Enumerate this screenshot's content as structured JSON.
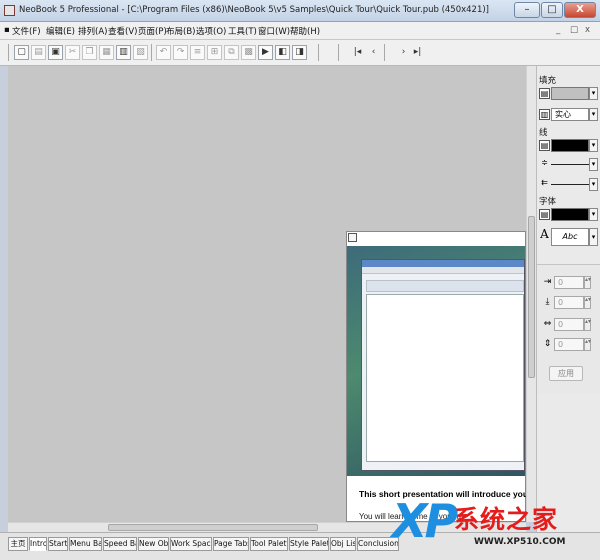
{
  "window": {
    "title": "NeoBook 5 Professional - [C:\\Program Files (x86)\\NeoBook 5\\v5 Samples\\Quick Tour\\Quick Tour.pub (450x421)]",
    "buttons": {
      "minimize": "–",
      "maximize": "□",
      "close": "X"
    }
  },
  "menu": {
    "items": [
      "文件(F)",
      "编辑(E)",
      "排列(A)",
      "查看(V)",
      "页面(P)",
      "布局(B)",
      "选项(O)",
      "工具(T)",
      "窗口(W)",
      "帮助(H)"
    ],
    "doc_buttons": {
      "minimize": "_",
      "restore": "□",
      "close": "x"
    }
  },
  "toolbar": {
    "icons": [
      "new-icon",
      "open-icon",
      "save-icon",
      "cut-icon",
      "copy-icon",
      "paste-icon",
      "delete-icon",
      "print-icon",
      "undo-icon",
      "redo-icon",
      "align-icon",
      "group-icon",
      "order-icon",
      "grid-icon",
      "preview-icon",
      "compile-icon"
    ],
    "nav": {
      "first": "|◂",
      "prev": "‹",
      "next": "›",
      "last": "▸|"
    }
  },
  "properties": {
    "fill_label": "填充",
    "fill_style": "实心",
    "line_label": "线",
    "font_label": "字体",
    "font_sample": "Abc",
    "fill_color": "#c0c0c0",
    "line_color": "#000000",
    "font_color": "#000000",
    "spin_x": "0",
    "spin_y": "0",
    "spin_w": "0",
    "spin_h": "0",
    "apply_label": "应用"
  },
  "page_preview": {
    "headline": "This short presentation will introduce you to",
    "subline": "You will learn some of your us"
  },
  "tabs": [
    "主页",
    "Intro",
    "Start",
    "Menu Bar",
    "Speed Bar",
    "New Obis",
    "Work Space",
    "Page Tabs",
    "Tool Palette",
    "Style Palette",
    "Obj List",
    "Conclusion"
  ],
  "watermark": {
    "xp": "XP",
    "brand": "系统之家",
    "url": "WWW.XP510.COM"
  }
}
